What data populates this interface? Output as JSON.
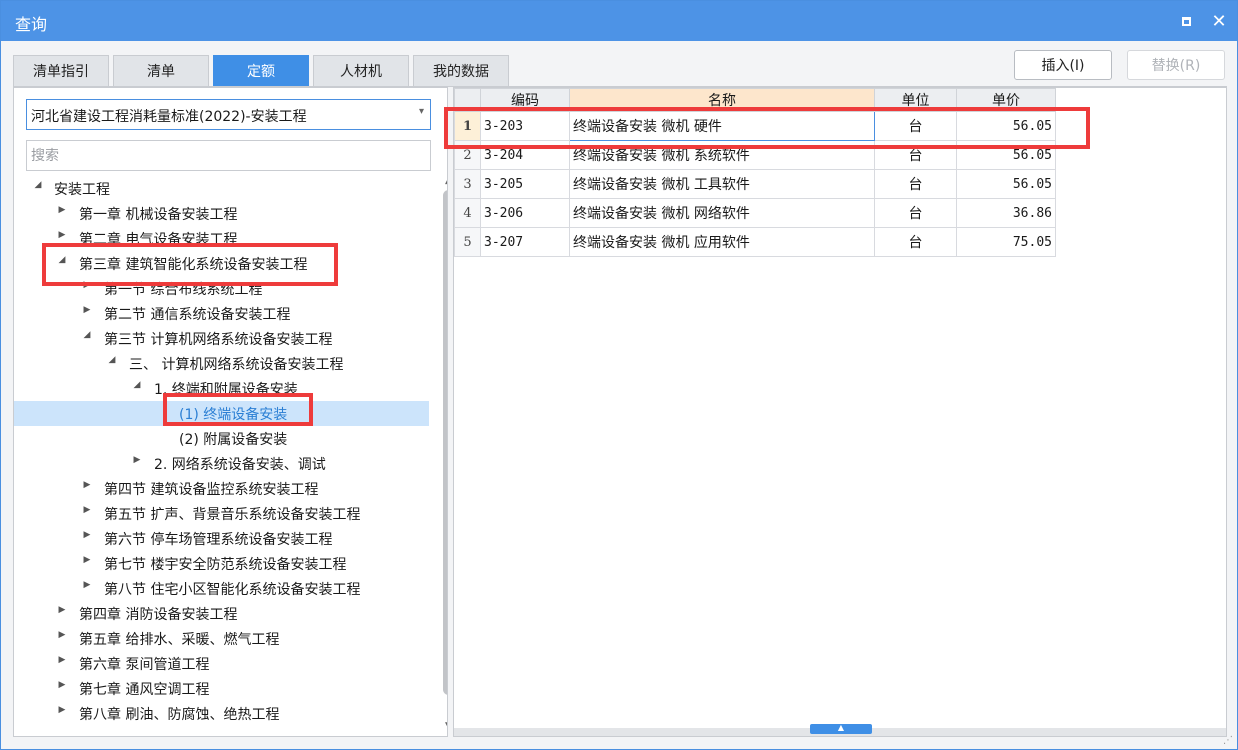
{
  "window": {
    "title": "查询",
    "maximize_icon": "maximize-icon",
    "close_icon": "close-icon",
    "close_glyph": "✕"
  },
  "tabs": [
    {
      "label": "清单指引",
      "active": false
    },
    {
      "label": "清单",
      "active": false
    },
    {
      "label": "定额",
      "active": true
    },
    {
      "label": "人材机",
      "active": false
    },
    {
      "label": "我的数据",
      "active": false
    }
  ],
  "actions": {
    "insert_label": "插入(I)",
    "replace_label": "替换(R)"
  },
  "left": {
    "library": "河北省建设工程消耗量标准(2022)-安装工程",
    "search_placeholder": "搜索",
    "tree": [
      {
        "label": "安装工程",
        "expanded": true
      },
      {
        "label": "第一章 机械设备安装工程",
        "expanded": false
      },
      {
        "label": "第二章 电气设备安装工程",
        "expanded": false
      },
      {
        "label": "第三章 建筑智能化系统设备安装工程",
        "expanded": true
      },
      {
        "label": "第一节 综合布线系统工程",
        "expanded": false
      },
      {
        "label": "第二节 通信系统设备安装工程",
        "expanded": false
      },
      {
        "label": "第三节 计算机网络系统设备安装工程",
        "expanded": true
      },
      {
        "label": "三、 计算机网络系统设备安装工程",
        "expanded": true
      },
      {
        "label": "1. 终端和附属设备安装",
        "expanded": true
      },
      {
        "label": "(1) 终端设备安装",
        "selected": true
      },
      {
        "label": "(2) 附属设备安装"
      },
      {
        "label": "2. 网络系统设备安装、调试",
        "expanded": false
      },
      {
        "label": "第四节 建筑设备监控系统安装工程",
        "expanded": false
      },
      {
        "label": "第五节 扩声、背景音乐系统设备安装工程",
        "expanded": false
      },
      {
        "label": "第六节 停车场管理系统设备安装工程",
        "expanded": false
      },
      {
        "label": "第七节 楼宇安全防范系统设备安装工程",
        "expanded": false
      },
      {
        "label": "第八节 住宅小区智能化系统设备安装工程",
        "expanded": false
      },
      {
        "label": "第四章 消防设备安装工程",
        "expanded": false
      },
      {
        "label": "第五章 给排水、采暖、燃气工程",
        "expanded": false
      },
      {
        "label": "第六章 泵间管道工程",
        "expanded": false
      },
      {
        "label": "第七章 通风空调工程",
        "expanded": false
      },
      {
        "label": "第八章 刷油、防腐蚀、绝热工程",
        "expanded": false
      }
    ]
  },
  "table": {
    "columns": [
      "编码",
      "名称",
      "单位",
      "单价"
    ],
    "rows": [
      {
        "idx": "1",
        "code": "3-203",
        "name": "终端设备安装 微机 硬件",
        "unit": "台",
        "price": "56.05"
      },
      {
        "idx": "2",
        "code": "3-204",
        "name": "终端设备安装 微机 系统软件",
        "unit": "台",
        "price": "56.05"
      },
      {
        "idx": "3",
        "code": "3-205",
        "name": "终端设备安装 微机 工具软件",
        "unit": "台",
        "price": "56.05"
      },
      {
        "idx": "4",
        "code": "3-206",
        "name": "终端设备安装 微机 网络软件",
        "unit": "台",
        "price": "36.86"
      },
      {
        "idx": "5",
        "code": "3-207",
        "name": "终端设备安装 微机 应用软件",
        "unit": "台",
        "price": "75.05"
      }
    ]
  },
  "colors": {
    "accent": "#3f8fe6",
    "titlebar": "#4d93e6",
    "highlight": "#ee3b3b",
    "selected_row": "#cce4fb"
  }
}
